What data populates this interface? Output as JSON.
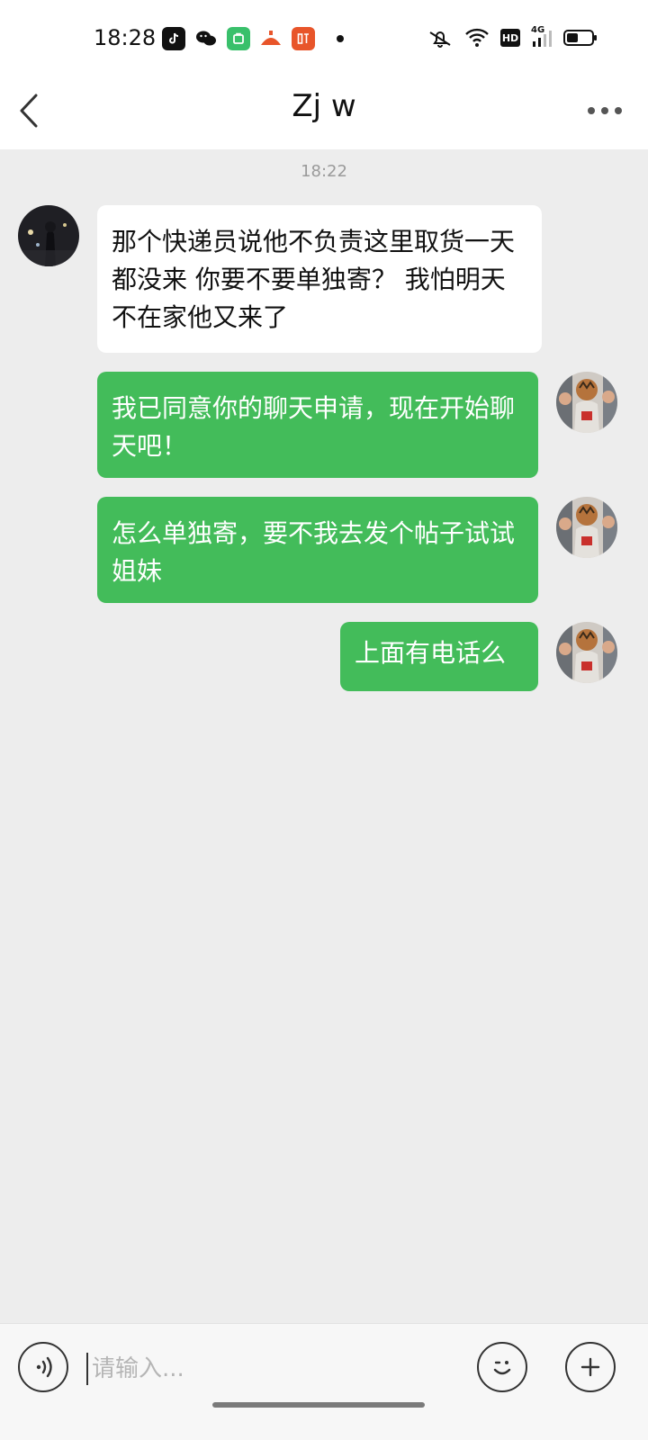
{
  "status_bar": {
    "time": "18:28",
    "notification_icons": [
      "tiktok-icon",
      "wechat-icon",
      "green-app-icon",
      "orange-app-icon",
      "radio-app-icon"
    ],
    "system_icons": [
      "mute-icon",
      "wifi-icon",
      "hd-icon",
      "4g-signal-icon",
      "battery-icon"
    ],
    "signal_label": "4G",
    "hd_label": "HD",
    "battery_level": 0.45
  },
  "nav": {
    "title": "Zj w"
  },
  "chat": {
    "timestamp": "18:22",
    "messages": [
      {
        "side": "in",
        "text": "那个快递员说他不负责这里取货一天都没来 你要不要单独寄？ 我怕明天不在家他又来了"
      },
      {
        "side": "out",
        "text": "我已同意你的聊天申请，现在开始聊天吧！"
      },
      {
        "side": "out",
        "text": "怎么单独寄，要不我去发个帖子试试姐妹"
      },
      {
        "side": "out",
        "text": "上面有电话么"
      }
    ]
  },
  "input": {
    "placeholder": "请输入..."
  },
  "colors": {
    "outgoing_bubble": "#43bc5a",
    "incoming_bubble": "#ffffff",
    "background": "#ededed"
  }
}
